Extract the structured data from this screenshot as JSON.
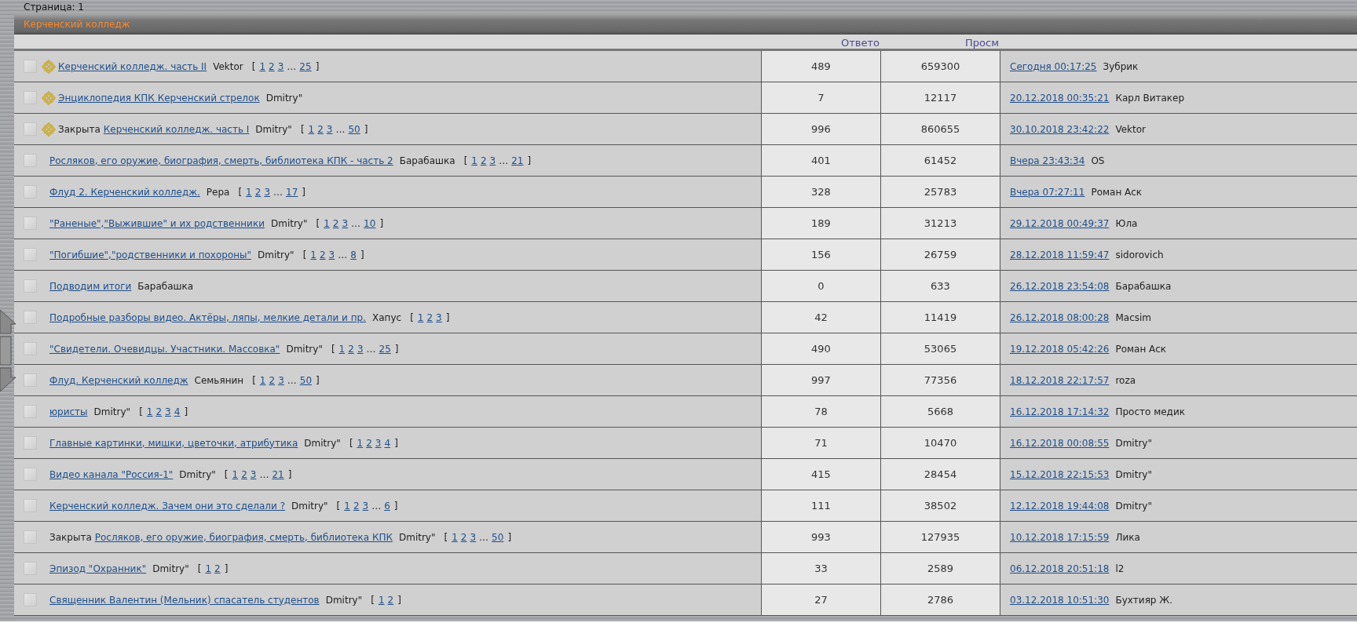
{
  "page_label": "Страница: 1",
  "forum": {
    "title": "Керченский колледж"
  },
  "columns": [
    "Ответо",
    "Просм"
  ],
  "topics": [
    {
      "sticky": true,
      "title": "Керченский колледж. часть II",
      "author": "Vektor",
      "pager": {
        "open": "[",
        "first": [
          "1",
          "2",
          "3"
        ],
        "gap": "…",
        "last": "25",
        "close": "]"
      },
      "replies": "489",
      "views": "659300",
      "last_post": {
        "date": "Сегодня 00:17:25",
        "author": "Зубрик"
      }
    },
    {
      "sticky": true,
      "title": "Энциклопедия КПК Керченский стрелок",
      "author": "Dmitry\"",
      "replies": "7",
      "views": "12117",
      "last_post": {
        "date": "20.12.2018 00:35:21",
        "author": "Карл Витакер"
      }
    },
    {
      "sticky": true,
      "status": "Закрыта",
      "title": "Керченский колледж. часть I",
      "author": "Dmitry\"",
      "pager": {
        "open": "[",
        "first": [
          "1",
          "2",
          "3"
        ],
        "gap": "…",
        "last": "50",
        "close": "]"
      },
      "replies": "996",
      "views": "860655",
      "last_post": {
        "date": "30.10.2018 23:42:22",
        "author": "Vektor"
      }
    },
    {
      "sticky": false,
      "title": "Росляков, его оружие, биография, смерть, библиотека КПК - часть 2",
      "author": "Барабашка",
      "pager": {
        "open": "[",
        "first": [
          "1",
          "2",
          "3"
        ],
        "gap": "…",
        "last": "21",
        "close": "]"
      },
      "replies": "401",
      "views": "61452",
      "last_post": {
        "date": "Вчера 23:43:34",
        "author": "OS"
      }
    },
    {
      "sticky": false,
      "title": "Флуд 2. Керченский колледж.",
      "author": "Рера",
      "pager": {
        "open": "[",
        "first": [
          "1",
          "2",
          "3"
        ],
        "gap": "…",
        "last": "17",
        "close": "]"
      },
      "replies": "328",
      "views": "25783",
      "last_post": {
        "date": "Вчера 07:27:11",
        "author": "Роман Аск"
      }
    },
    {
      "sticky": false,
      "title": "\"Раненые\",\"Выжившие\" и их родственники",
      "author": "Dmitry\"",
      "pager": {
        "open": "[",
        "first": [
          "1",
          "2",
          "3"
        ],
        "gap": "…",
        "last": "10",
        "close": "]"
      },
      "replies": "189",
      "views": "31213",
      "last_post": {
        "date": "29.12.2018 00:49:37",
        "author": "Юла"
      }
    },
    {
      "sticky": false,
      "title": "\"Погибшие\",\"родственники и похороны\"",
      "author": "Dmitry\"",
      "pager": {
        "open": "[",
        "first": [
          "1",
          "2",
          "3"
        ],
        "gap": "…",
        "last": "8",
        "close": "]"
      },
      "replies": "156",
      "views": "26759",
      "last_post": {
        "date": "28.12.2018 11:59:47",
        "author": "sidorovich"
      }
    },
    {
      "sticky": false,
      "title": "Подводим итоги",
      "author": "Барабашка",
      "replies": "0",
      "views": "633",
      "last_post": {
        "date": "26.12.2018 23:54:08",
        "author": "Барабашка"
      }
    },
    {
      "sticky": false,
      "title": "Подробные разборы видео. Актёры, ляпы, мелкие детали и пр.",
      "author": "Хапус",
      "pager": {
        "open": "[",
        "first": [
          "1",
          "2",
          "3"
        ],
        "close": "]"
      },
      "replies": "42",
      "views": "11419",
      "last_post": {
        "date": "26.12.2018 08:00:28",
        "author": "Macsim"
      }
    },
    {
      "sticky": false,
      "title": "\"Свидетели. Очевидцы. Участники. Массовка\"",
      "author": "Dmitry\"",
      "pager": {
        "open": "[",
        "first": [
          "1",
          "2",
          "3"
        ],
        "gap": "…",
        "last": "25",
        "close": "]"
      },
      "replies": "490",
      "views": "53065",
      "last_post": {
        "date": "19.12.2018 05:42:26",
        "author": "Роман Аск"
      }
    },
    {
      "sticky": false,
      "title": "Флуд. Керченский колледж",
      "author": "Семьянин",
      "pager": {
        "open": "[",
        "first": [
          "1",
          "2",
          "3"
        ],
        "gap": "…",
        "last": "50",
        "close": "]"
      },
      "replies": "997",
      "views": "77356",
      "last_post": {
        "date": "18.12.2018 22:17:57",
        "author": "roza"
      }
    },
    {
      "sticky": false,
      "title": "юристы",
      "author": "Dmitry\"",
      "pager": {
        "open": "[",
        "first": [
          "1",
          "2",
          "3",
          "4"
        ],
        "close": "]"
      },
      "replies": "78",
      "views": "5668",
      "last_post": {
        "date": "16.12.2018 17:14:32",
        "author": "Просто медик"
      }
    },
    {
      "sticky": false,
      "title": "Главные картинки, мишки, цветочки, атрибутика",
      "author": "Dmitry\"",
      "pager": {
        "open": "[",
        "first": [
          "1",
          "2",
          "3",
          "4"
        ],
        "close": "]"
      },
      "replies": "71",
      "views": "10470",
      "last_post": {
        "date": "16.12.2018 00:08:55",
        "author": "Dmitry\""
      }
    },
    {
      "sticky": false,
      "title": "Видео канала \"Россия-1\"",
      "author": "Dmitry\"",
      "pager": {
        "open": "[",
        "first": [
          "1",
          "2",
          "3"
        ],
        "gap": "…",
        "last": "21",
        "close": "]"
      },
      "replies": "415",
      "views": "28454",
      "last_post": {
        "date": "15.12.2018 22:15:53",
        "author": "Dmitry\""
      }
    },
    {
      "sticky": false,
      "title": "Керченский колледж. Зачем они это сделали ?",
      "author": "Dmitry\"",
      "pager": {
        "open": "[",
        "first": [
          "1",
          "2",
          "3"
        ],
        "gap": "…",
        "last": "6",
        "close": "]"
      },
      "replies": "111",
      "views": "38502",
      "last_post": {
        "date": "12.12.2018 19:44:08",
        "author": "Dmitry\""
      }
    },
    {
      "sticky": false,
      "status": "Закрыта",
      "title": "Росляков, его оружие, биография, смерть, библиотека КПК",
      "author": "Dmitry\"",
      "pager": {
        "open": "[",
        "first": [
          "1",
          "2",
          "3"
        ],
        "gap": "…",
        "last": "50",
        "close": "]"
      },
      "replies": "993",
      "views": "127935",
      "last_post": {
        "date": "10.12.2018 17:15:59",
        "author": "Лика"
      }
    },
    {
      "sticky": false,
      "title": "Эпизод \"Охранник\"",
      "author": "Dmitry\"",
      "pager": {
        "open": "[",
        "first": [
          "1",
          "2"
        ],
        "close": "]"
      },
      "replies": "33",
      "views": "2589",
      "last_post": {
        "date": "06.12.2018 20:51:18",
        "author": "l2"
      }
    },
    {
      "sticky": false,
      "title": "Священник Валентин (Мельник) спасатель студентов",
      "author": "Dmitry\"",
      "pager": {
        "open": "[",
        "first": [
          "1",
          "2"
        ],
        "close": "]"
      },
      "replies": "27",
      "views": "2786",
      "last_post": {
        "date": "03.12.2018 10:51:30",
        "author": "Бухтияр Ж."
      }
    }
  ]
}
